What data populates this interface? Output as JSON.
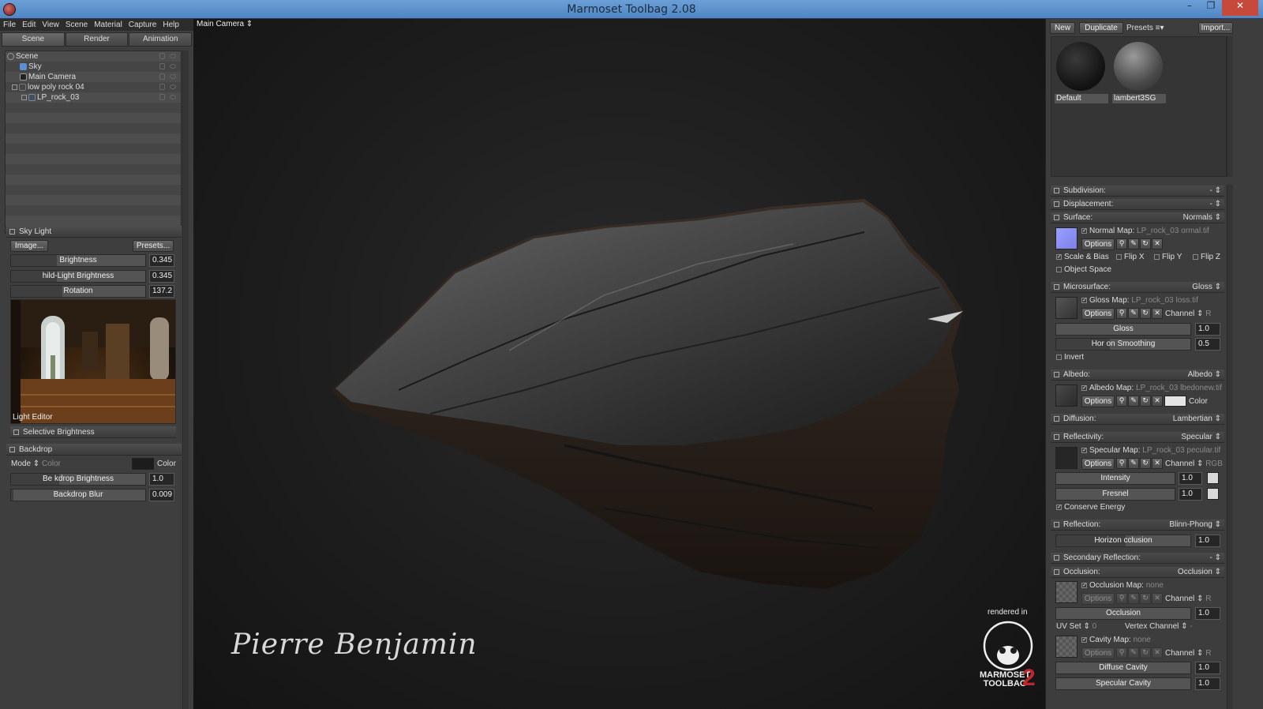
{
  "window": {
    "title": "Marmoset Toolbag 2.08",
    "min": "–",
    "max": "❐",
    "close": "✕"
  },
  "menu": [
    "File",
    "Edit",
    "View",
    "Scene",
    "Material",
    "Capture",
    "Help"
  ],
  "tabs": [
    "Scene",
    "Render",
    "Animation"
  ],
  "scene_tree": [
    "Scene",
    "Sky",
    "Main Camera",
    "low poly rock 04",
    "LP_rock_03"
  ],
  "sky_light": {
    "header": "Sky Light",
    "image_button": "Image...",
    "presets_button": "Presets...",
    "brightness_label": "Brightness",
    "brightness_value": "0.345",
    "child_label": "hild-Light Brightness",
    "child_value": "0.345",
    "rotation_label": "Rotation",
    "rotation_value": "137.2",
    "light_editor": "Light Editor",
    "selective": "Selective Brightness"
  },
  "backdrop": {
    "header": "Backdrop",
    "mode_label": "Mode",
    "mode_value": "Color",
    "color_label": "Color",
    "color": "#1c1c1c",
    "brightness_label": "Be  kdrop Brightness",
    "brightness_value": "1.0",
    "blur_label": "Backdrop Blur",
    "blur_value": "0.009"
  },
  "viewport": {
    "camera": "Main Camera",
    "signature": "Pierre Benjamin",
    "rendered_in": "rendered in",
    "logo_line1": "MARMOSET",
    "logo_line2": "TOOLBAG",
    "logo_num": "2"
  },
  "materials_toolbar": {
    "new": "New",
    "duplicate": "Duplicate",
    "presets": "Presets",
    "import": "Import..."
  },
  "materials": [
    {
      "name": "Default"
    },
    {
      "name": "lambert3SG"
    }
  ],
  "props": {
    "subdivision": "Subdivision:",
    "subdivision_value": "-",
    "displacement": "Displacement:",
    "displacement_value": "-",
    "surface": "Surface:",
    "surface_value": "Normals",
    "normal_map_label": "Normal Map:",
    "normal_map_file": "LP_rock_03 ormal.tif",
    "options": "Options",
    "scale_bias": "Scale & Bias",
    "flip_x": "Flip X",
    "flip_y": "Flip Y",
    "flip_z": "Flip Z",
    "object_space": "Object Space",
    "microsurface": "Microsurface:",
    "microsurface_value": "Gloss",
    "gloss_map_label": "Gloss Map:",
    "gloss_map_file": "LP_rock_03 loss.tif",
    "channel": "Channel",
    "channel_r": "R",
    "gloss_label": "Gloss",
    "gloss_value": "1.0",
    "horizon_smoothing": "Hor  on Smoothing",
    "horizon_smoothing_value": "0.5",
    "invert": "Invert",
    "albedo": "Albedo:",
    "albedo_value": "Albedo",
    "albedo_map_label": "Albedo Map:",
    "albedo_map_file": "LP_rock_03 lbedonew.tif",
    "color": "Color",
    "diffusion": "Diffusion:",
    "diffusion_value": "Lambertian",
    "reflectivity": "Reflectivity:",
    "reflectivity_value": "Specular",
    "specular_map_label": "Specular Map:",
    "specular_map_file": "LP_rock_03 pecular.tif",
    "channel_rgb": "RGB",
    "intensity_label": "Intensity",
    "intensity_value": "1.0",
    "fresnel_label": "Fresnel",
    "fresnel_value": "1.0",
    "conserve_energy": "Conserve Energy",
    "reflection": "Reflection:",
    "reflection_value": "Blinn-Phong",
    "horizon_occlusion": "Horizon  cclusion",
    "horizon_occlusion_value": "1.0",
    "secondary_reflection": "Secondary Reflection:",
    "secondary_reflection_value": "-",
    "occlusion": "Occlusion:",
    "occlusion_value": "Occlusion",
    "occlusion_map_label": "Occlusion Map:",
    "occlusion_map_file": "none",
    "occlusion_label": "Occlusion",
    "occlusion_slider_value": "1.0",
    "uv_set": "UV Set",
    "uv_set_value": "0",
    "vertex_channel": "Vertex Channel",
    "vertex_channel_value": "-",
    "cavity_map_label": "Cavity Map:",
    "cavity_map_file": "none",
    "diffuse_cavity": "Diffuse Cavity",
    "diffuse_cavity_value": "1.0",
    "specular_cavity": "Specular Cavity",
    "specular_cavity_value": "1.0"
  },
  "colors": {
    "title_bar": "#5a8fcc",
    "close": "#c7493c",
    "logo_red": "#c0262c"
  }
}
